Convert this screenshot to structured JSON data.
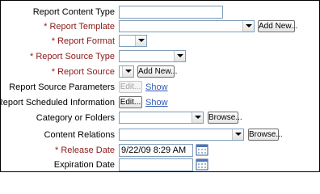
{
  "form": {
    "report_content_type": {
      "label": "Report Content Type",
      "value": ""
    },
    "report_template": {
      "label": "* Report Template",
      "value": "",
      "add_label": "Add New..."
    },
    "report_format": {
      "label": "* Report Format",
      "value": ""
    },
    "report_source_type": {
      "label": "* Report Source Type",
      "value": ""
    },
    "report_source": {
      "label": "* Report Source",
      "value": "",
      "add_label": "Add New..."
    },
    "report_source_parameters": {
      "label": "Report Source Parameters",
      "edit_label": "Edit...",
      "show_label": "Show"
    },
    "report_scheduled_information": {
      "label": "Report Scheduled Information",
      "edit_label": "Edit...",
      "show_label": "Show"
    },
    "category_or_folders": {
      "label": "Category or Folders",
      "value": "",
      "browse_label": "Browse..."
    },
    "content_relations": {
      "label": "Content Relations",
      "value": "",
      "browse_label": "Browse..."
    },
    "release_date": {
      "label": "* Release Date",
      "value": "9/22/09 8:29 AM"
    },
    "expiration_date": {
      "label": "Expiration Date",
      "value": ""
    }
  },
  "icons": {
    "select_arrow": "chevron-down-icon",
    "calendar": "calendar-icon"
  },
  "colors": {
    "required_label": "#8b1a1a",
    "link": "#2f5bb7",
    "input_border": "#7f9db9"
  }
}
